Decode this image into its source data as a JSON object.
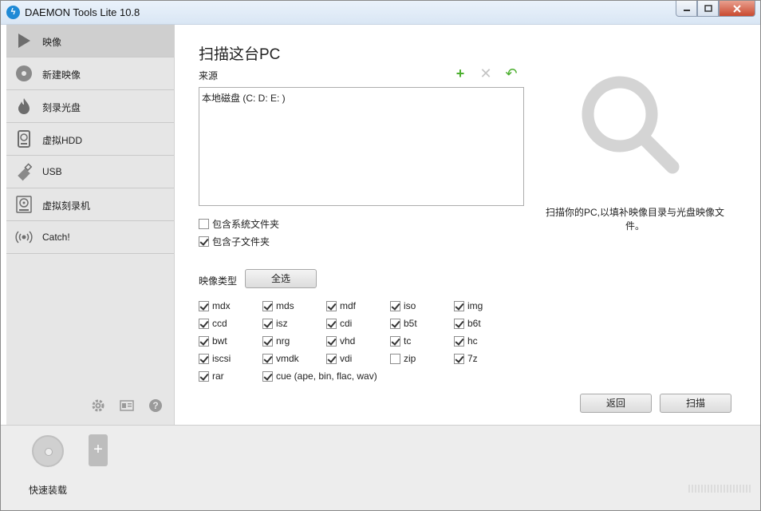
{
  "window": {
    "title": "DAEMON Tools Lite 10.8",
    "app_icon": "lightning-icon"
  },
  "sidebar": {
    "items": [
      {
        "label": "映像",
        "icon": "play-icon",
        "active": true
      },
      {
        "label": "新建映像",
        "icon": "disc-icon"
      },
      {
        "label": "刻录光盘",
        "icon": "flame-icon"
      },
      {
        "label": "虚拟HDD",
        "icon": "hdd-icon"
      },
      {
        "label": "USB",
        "icon": "usb-icon"
      },
      {
        "label": "虚拟刻录机",
        "icon": "burner-icon"
      },
      {
        "label": "Catch!",
        "icon": "catch-icon"
      }
    ],
    "tools": [
      "gear-icon",
      "license-icon",
      "help-icon"
    ]
  },
  "main": {
    "title": "扫描这台PC",
    "source_label": "来源",
    "source_entries": [
      "本地磁盘 (C: D: E: )"
    ],
    "options": [
      {
        "label": "包含系统文件夹",
        "checked": false
      },
      {
        "label": "包含子文件夹",
        "checked": true
      }
    ],
    "types_label": "映像类型",
    "select_all": "全选",
    "types": [
      [
        {
          "label": "mdx",
          "checked": true
        },
        {
          "label": "mds",
          "checked": true
        },
        {
          "label": "mdf",
          "checked": true
        },
        {
          "label": "iso",
          "checked": true
        },
        {
          "label": "img",
          "checked": true
        }
      ],
      [
        {
          "label": "ccd",
          "checked": true
        },
        {
          "label": "isz",
          "checked": true
        },
        {
          "label": "cdi",
          "checked": true
        },
        {
          "label": "b5t",
          "checked": true
        },
        {
          "label": "b6t",
          "checked": true
        }
      ],
      [
        {
          "label": "bwt",
          "checked": true
        },
        {
          "label": "nrg",
          "checked": true
        },
        {
          "label": "vhd",
          "checked": true
        },
        {
          "label": "tc",
          "checked": true
        },
        {
          "label": "hc",
          "checked": true
        }
      ],
      [
        {
          "label": "iscsi",
          "checked": true
        },
        {
          "label": "vmdk",
          "checked": true
        },
        {
          "label": "vdi",
          "checked": true
        },
        {
          "label": "zip",
          "checked": false
        },
        {
          "label": "7z",
          "checked": true
        }
      ],
      [
        {
          "label": "rar",
          "checked": true
        },
        {
          "label": "cue (ape, bin, flac, wav)",
          "checked": true
        }
      ]
    ],
    "help_text": "扫描你的PC,以填补映像目录与光盘映像文件。",
    "back_button": "返回",
    "scan_button": "扫描"
  },
  "bottom": {
    "quick_mount": "快速装载"
  }
}
